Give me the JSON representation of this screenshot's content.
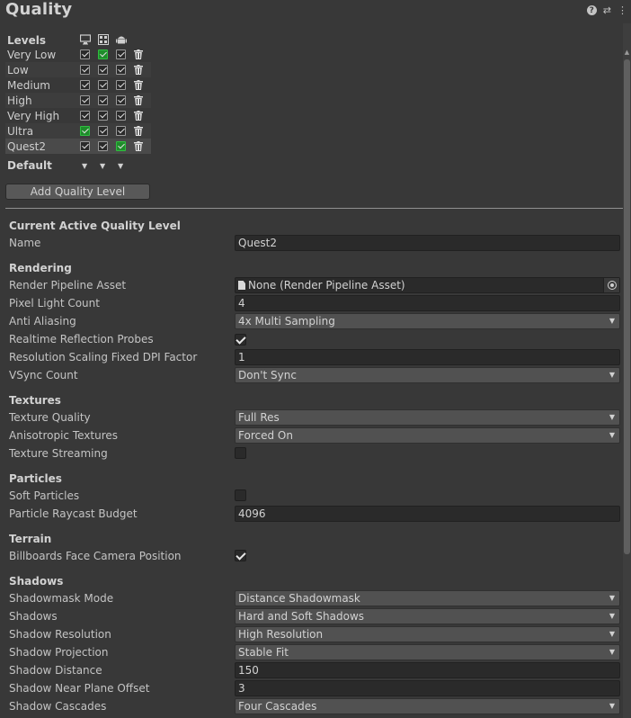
{
  "header": {
    "title": "Quality",
    "icons": [
      "help-icon",
      "settings-sliders-icon",
      "more-menu-icon"
    ]
  },
  "levels": {
    "title": "Levels",
    "platform_icons": [
      "desktop-icon",
      "webgl-icon",
      "android-icon"
    ],
    "rows": [
      {
        "name": "Very Low",
        "checks": [
          "on",
          "green",
          "on"
        ]
      },
      {
        "name": "Low",
        "checks": [
          "on",
          "on",
          "on"
        ]
      },
      {
        "name": "Medium",
        "checks": [
          "on",
          "on",
          "on"
        ]
      },
      {
        "name": "High",
        "checks": [
          "on",
          "on",
          "on"
        ]
      },
      {
        "name": "Very High",
        "checks": [
          "on",
          "on",
          "on"
        ]
      },
      {
        "name": "Ultra",
        "checks": [
          "green",
          "on",
          "on"
        ]
      },
      {
        "name": "Quest2",
        "checks": [
          "on",
          "on",
          "green"
        ]
      }
    ],
    "default_label": "Default",
    "add_button": "Add Quality Level"
  },
  "current": {
    "section": "Current Active Quality Level",
    "name_label": "Name",
    "name_value": "Quest2"
  },
  "rendering": {
    "section": "Rendering",
    "pipeline_label": "Render Pipeline Asset",
    "pipeline_value": "None (Render Pipeline Asset)",
    "pixel_light_label": "Pixel Light Count",
    "pixel_light_value": "4",
    "aa_label": "Anti Aliasing",
    "aa_value": "4x Multi Sampling",
    "rrp_label": "Realtime Reflection Probes",
    "rrp_checked": true,
    "dpi_label": "Resolution Scaling Fixed DPI Factor",
    "dpi_value": "1",
    "vsync_label": "VSync Count",
    "vsync_value": "Don't Sync"
  },
  "textures": {
    "section": "Textures",
    "quality_label": "Texture Quality",
    "quality_value": "Full Res",
    "aniso_label": "Anisotropic Textures",
    "aniso_value": "Forced On",
    "streaming_label": "Texture Streaming",
    "streaming_checked": false
  },
  "particles": {
    "section": "Particles",
    "soft_label": "Soft Particles",
    "soft_checked": false,
    "raycast_label": "Particle Raycast Budget",
    "raycast_value": "4096"
  },
  "terrain": {
    "section": "Terrain",
    "billboards_label": "Billboards Face Camera Position",
    "billboards_checked": true
  },
  "shadows": {
    "section": "Shadows",
    "mask_label": "Shadowmask Mode",
    "mask_value": "Distance Shadowmask",
    "shadows_label": "Shadows",
    "shadows_value": "Hard and Soft Shadows",
    "res_label": "Shadow Resolution",
    "res_value": "High Resolution",
    "proj_label": "Shadow Projection",
    "proj_value": "Stable Fit",
    "dist_label": "Shadow Distance",
    "dist_value": "150",
    "near_label": "Shadow Near Plane Offset",
    "near_value": "3",
    "cascades_label": "Shadow Cascades",
    "cascades_value": "Four Cascades"
  },
  "colors": {
    "background": "#383838",
    "check_green": "#1f8c2b",
    "field_bg": "#2a2a2a",
    "dropdown_bg": "#515151"
  }
}
